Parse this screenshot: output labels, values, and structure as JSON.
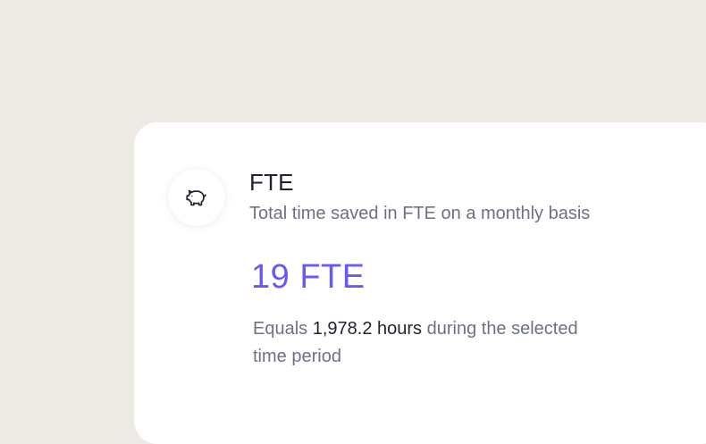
{
  "card": {
    "icon": "piggy-bank-icon",
    "title": "FTE",
    "subtitle": "Total time saved in FTE on a monthly basis",
    "metric": "19 FTE",
    "description": {
      "prefix": "Equals ",
      "highlight": "1,978.2 hours",
      "suffix": " during the selected time period"
    }
  },
  "colors": {
    "background": "#ede9e4",
    "card": "#ffffff",
    "accent": "#6759f5",
    "muted_text": "#6b7285",
    "primary_text": "#1f2330"
  }
}
